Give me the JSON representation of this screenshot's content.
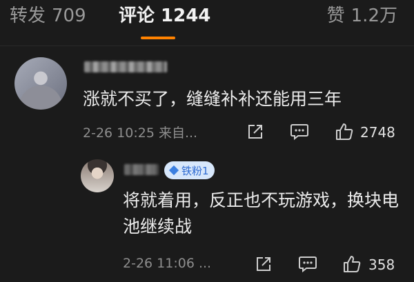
{
  "tabs": {
    "repost": {
      "label": "转发",
      "count": "709"
    },
    "comment": {
      "label": "评论",
      "count": "1244"
    },
    "like": {
      "label": "赞",
      "count": "1.2万"
    }
  },
  "comments": [
    {
      "text": "涨就不买了，缝缝补补还能用三年",
      "time": "2-26 10:25 来自...",
      "likes": "2748"
    },
    {
      "badge": "铁粉1",
      "text": "将就着用，反正也不玩游戏，换块电池继续战",
      "time": "2-26 11:06 ...",
      "likes": "358"
    }
  ],
  "colors": {
    "accent": "#ff8200",
    "background": "#1b1b1b",
    "badge_bg": "#d7e7fb",
    "badge_text": "#2f6bd1"
  },
  "icons": [
    "share-icon",
    "comment-icon",
    "like-icon",
    "fan-badge-diamond-icon"
  ]
}
